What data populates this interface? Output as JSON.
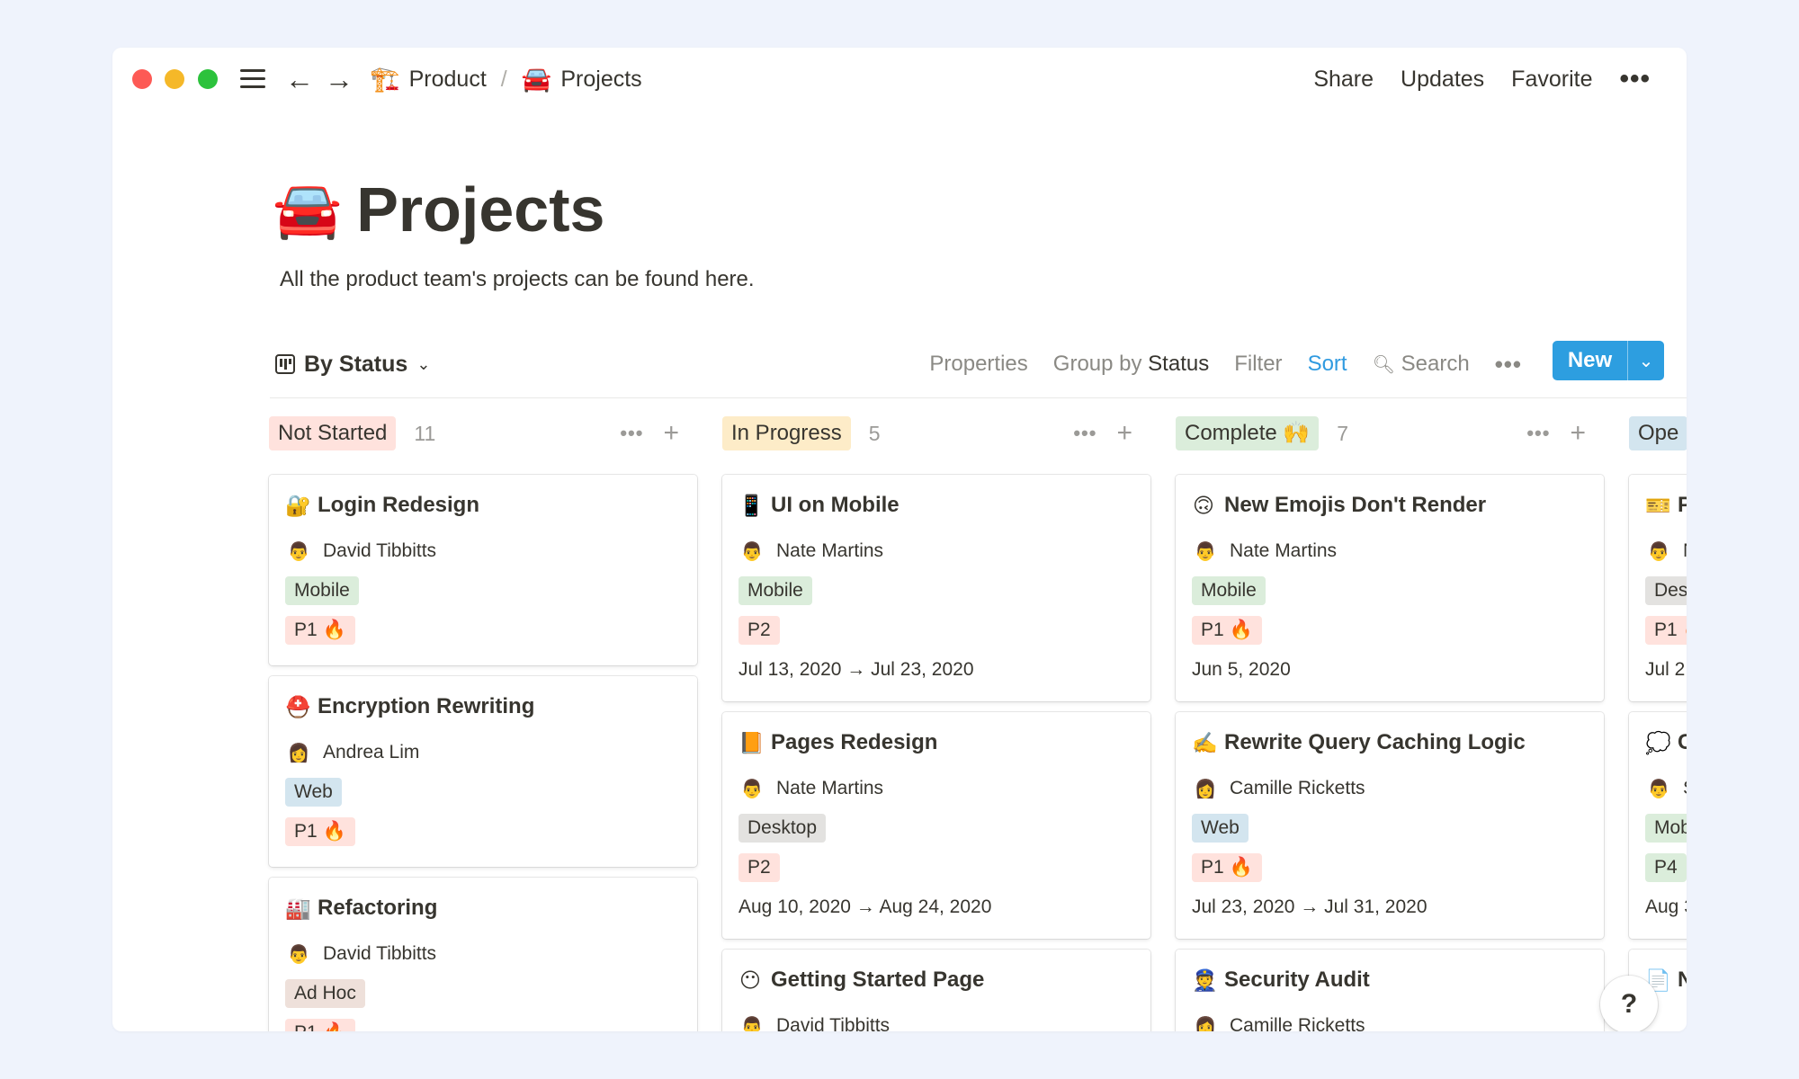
{
  "breadcrumb": [
    {
      "emoji": "🏗️",
      "label": "Product"
    },
    {
      "emoji": "🚘",
      "label": "Projects"
    }
  ],
  "breadcrumb_separator": "/",
  "top_actions": {
    "share": "Share",
    "updates": "Updates",
    "favorite": "Favorite",
    "more": "•••"
  },
  "page": {
    "emoji": "🚘",
    "title": "Projects",
    "description": "All the product team's projects can be found here."
  },
  "toolbar": {
    "view": "By Status",
    "properties": "Properties",
    "group_by_prefix": "Group by",
    "group_by_value": "Status",
    "filter": "Filter",
    "sort": "Sort",
    "search": "Search",
    "more": "•••",
    "new": "New"
  },
  "columns": [
    {
      "status": "Not Started",
      "count": "11",
      "color": "#ffe2dd",
      "cards": [
        {
          "emoji": "🔐",
          "title": "Login Redesign",
          "person_emoji": "👨",
          "person": "David Tibbitts",
          "tag": "Mobile",
          "tag_class": "mobile",
          "priority": "P1 🔥",
          "date": ""
        },
        {
          "emoji": "⛑️",
          "title": "Encryption Rewriting",
          "person_emoji": "👩",
          "person": "Andrea Lim",
          "tag": "Web",
          "tag_class": "web",
          "priority": "P1 🔥",
          "date": ""
        },
        {
          "emoji": "🏭",
          "title": "Refactoring",
          "person_emoji": "👨",
          "person": "David Tibbitts",
          "tag": "Ad Hoc",
          "tag_class": "adhoc",
          "priority": "P1 🔥",
          "date": ""
        }
      ]
    },
    {
      "status": "In Progress",
      "count": "5",
      "color": "#fdecc8",
      "cards": [
        {
          "emoji": "📱",
          "title": "UI on Mobile",
          "person_emoji": "👨",
          "person": "Nate Martins",
          "tag": "Mobile",
          "tag_class": "mobile",
          "priority": "P2",
          "date": "Jul 13, 2020 → Jul 23, 2020"
        },
        {
          "emoji": "📙",
          "title": "Pages Redesign",
          "person_emoji": "👨",
          "person": "Nate Martins",
          "tag": "Desktop",
          "tag_class": "desktop",
          "priority": "P2",
          "date": "Aug 10, 2020 → Aug 24, 2020"
        },
        {
          "emoji": "😶",
          "title": "Getting Started Page",
          "person_emoji": "👨",
          "person": "David Tibbitts",
          "tag": "",
          "tag_class": "",
          "priority": "",
          "date": ""
        }
      ]
    },
    {
      "status": "Complete 🙌",
      "count": "7",
      "color": "#dbeddb",
      "cards": [
        {
          "emoji": "🙃",
          "title": "New Emojis Don't Render",
          "person_emoji": "👨",
          "person": "Nate Martins",
          "tag": "Mobile",
          "tag_class": "mobile",
          "priority": "P1 🔥",
          "date": "Jun 5, 2020"
        },
        {
          "emoji": "✍️",
          "title": "Rewrite Query Caching Logic",
          "person_emoji": "👩",
          "person": "Camille Ricketts",
          "tag": "Web",
          "tag_class": "web",
          "priority": "P1 🔥",
          "date": "Jul 23, 2020 → Jul 31, 2020"
        },
        {
          "emoji": "👮",
          "title": "Security Audit",
          "person_emoji": "👩",
          "person": "Camille Ricketts",
          "tag": "",
          "tag_class": "",
          "priority": "",
          "date": ""
        }
      ]
    },
    {
      "status": "Ope",
      "count": "",
      "color": "#d3e5ef",
      "cards": [
        {
          "emoji": "🎫",
          "title": "P",
          "person_emoji": "👨",
          "person": "N",
          "tag": "Des",
          "tag_class": "design",
          "priority": "P1 🔥",
          "date": "Jul 2"
        },
        {
          "emoji": "💭",
          "title": "C",
          "person_emoji": "👨",
          "person": "S",
          "tag": "Mob",
          "tag_class": "mobile",
          "priority": "P4",
          "date": "Aug 3"
        },
        {
          "emoji": "📄",
          "title": "N",
          "person_emoji": "",
          "person": "",
          "tag": "",
          "tag_class": "",
          "priority": "",
          "date": ""
        }
      ]
    }
  ],
  "help": "?"
}
